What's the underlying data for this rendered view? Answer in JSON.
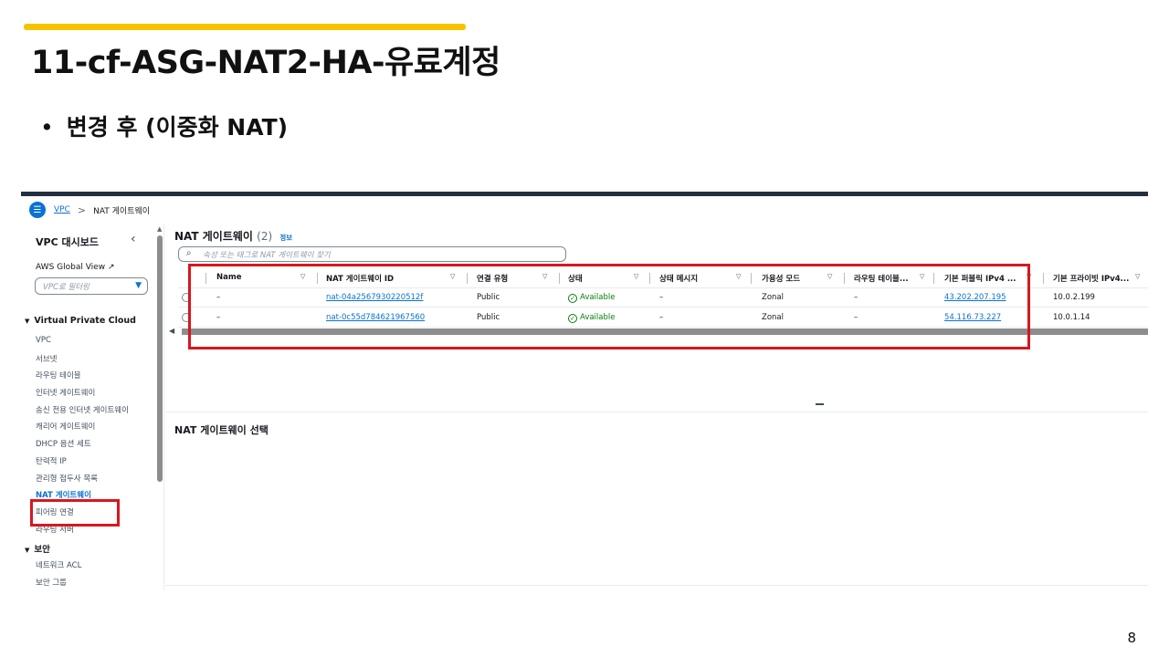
{
  "slide": {
    "title": "11-cf-ASG-NAT2-HA-유료계정",
    "bullet": "변경 후 (이중화 NAT)",
    "page_number": "8",
    "accent_color": "#f5c400",
    "highlight_color": "#d9161e"
  },
  "console": {
    "breadcrumb": {
      "root": "VPC",
      "separator": ">",
      "current": "NAT 게이트웨이"
    },
    "sidebar": {
      "title": "VPC 대시보드",
      "global_view": "AWS Global View",
      "filter_placeholder": "VPC로 필터링",
      "sections": [
        {
          "label": "Virtual Private Cloud",
          "items": [
            "VPC",
            "서브넷",
            "라우팅 테이블",
            "인터넷 게이트웨이",
            "송신 전용 인터넷 게이트웨이",
            "캐리어 게이트웨이",
            "DHCP 옵션 세트",
            "탄력적 IP",
            "관리형 접두사 목록",
            "NAT 게이트웨이",
            "피어링 연결",
            "라우팅 서버"
          ]
        },
        {
          "label": "보안",
          "items": [
            "네트워크 ACL",
            "보안 그룹"
          ]
        }
      ],
      "active_item": "NAT 게이트웨이"
    },
    "main": {
      "title": "NAT 게이트웨이",
      "count": "(2)",
      "info_link": "정보",
      "search_placeholder": "속성 또는 태그로 NAT 게이트웨이 찾기",
      "columns": [
        "Name",
        "NAT 게이트웨이 ID",
        "연결 유형",
        "상태",
        "상태 메시지",
        "가용성 모드",
        "라우팅 테이블...",
        "기본 퍼블릭 IPv4 ...",
        "기본 프라이빗 IPv4..."
      ],
      "rows": [
        [
          "–",
          "nat-04a2567930220512f",
          "Public",
          "Available",
          "–",
          "Zonal",
          "–",
          "43.202.207.195",
          "10.0.2.199"
        ],
        [
          "–",
          "nat-0c55d784621967560",
          "Public",
          "Available",
          "–",
          "Zonal",
          "–",
          "54.116.73.227",
          "10.0.1.14"
        ]
      ],
      "detail_title": "NAT 게이트웨이 선택"
    }
  }
}
